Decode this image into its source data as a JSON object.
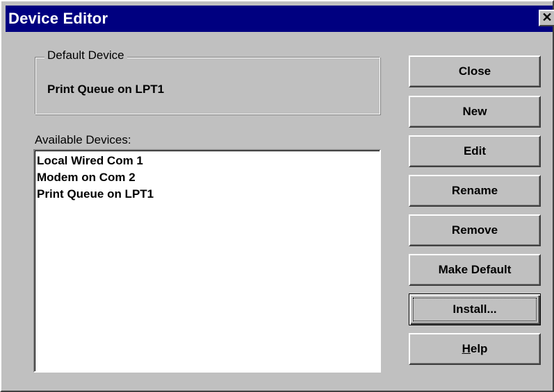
{
  "window": {
    "title": "Device Editor",
    "close_glyph": "✕"
  },
  "default_device": {
    "legend": "Default Device",
    "value": "Print Queue on LPT1"
  },
  "available_devices": {
    "label": "Available Devices:",
    "items": [
      "Local Wired Com 1",
      "Modem on Com 2",
      "Print Queue on LPT1"
    ]
  },
  "buttons": {
    "close": "Close",
    "new": "New",
    "edit": "Edit",
    "rename": "Rename",
    "remove": "Remove",
    "make_default": "Make Default",
    "install": "Install...",
    "help_mnemonic": "H",
    "help_rest": "elp"
  },
  "colors": {
    "titlebar": "#000080",
    "face": "#c0c0c0"
  }
}
